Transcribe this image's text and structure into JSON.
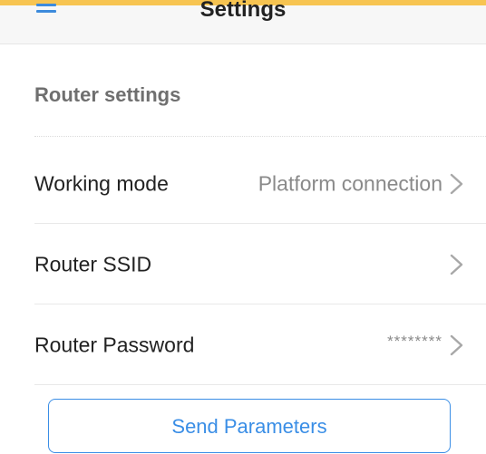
{
  "header": {
    "title": "Settings",
    "menu_icon": "hamburger-menu-icon",
    "accent_color": "#f7c451"
  },
  "section": {
    "title": "Router settings"
  },
  "rows": [
    {
      "label": "Working mode",
      "value": "Platform connection",
      "icon": "chevron-right-icon"
    },
    {
      "label": "Router SSID",
      "value": "",
      "icon": "chevron-right-icon"
    },
    {
      "label": "Router Password",
      "value": "********",
      "icon": "chevron-right-icon"
    }
  ],
  "actions": {
    "send_label": "Send Parameters",
    "button_color": "#3a8ee6"
  }
}
